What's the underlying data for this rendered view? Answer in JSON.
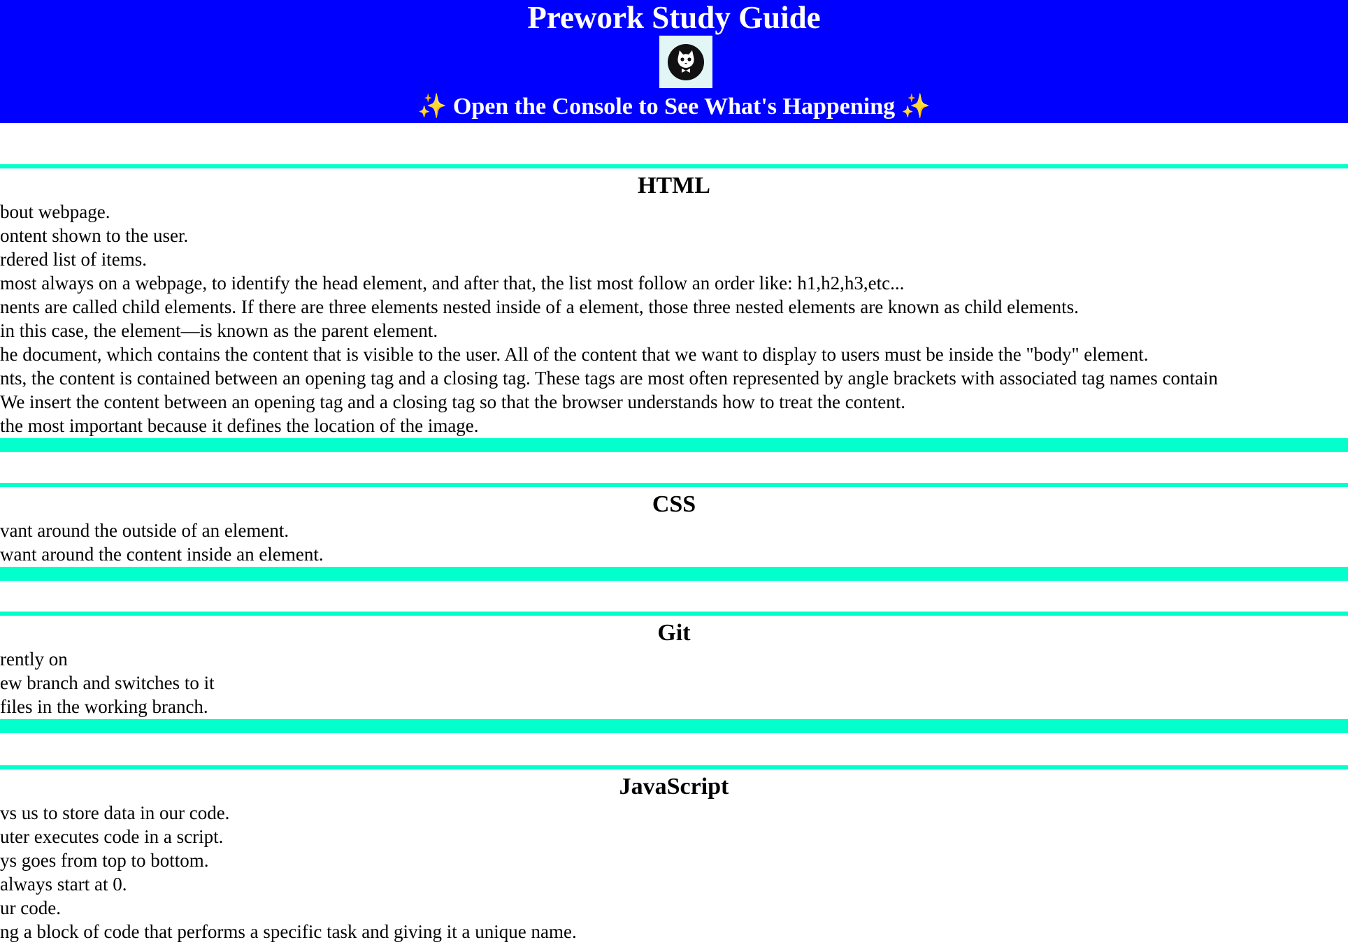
{
  "header": {
    "title": "Prework Study Guide",
    "subtitle_sparkle_left": "✨",
    "subtitle": "Open the Console to See What's Happening",
    "subtitle_sparkle_right": "✨"
  },
  "sections": {
    "html": {
      "heading": "HTML",
      "items": [
        "bout webpage.",
        "ontent shown to the user.",
        "rdered list of items.",
        "most always on a webpage, to identify the head element, and after that, the list most follow an order like: h1,h2,h3,etc...",
        "nents are called child elements. If there are three elements nested inside of a element, those three nested elements are known as child elements.",
        "in this case, the element—is known as the parent element.",
        "he document, which contains the content that is visible to the user. All of the content that we want to display to users must be inside the \"body\" element.",
        "nts, the content is contained between an opening tag and a closing tag. These tags are most often represented by angle brackets with associated tag names contain",
        "We insert the content between an opening tag and a closing tag so that the browser understands how to treat the content.",
        " the most important because it defines the location of the image."
      ]
    },
    "css": {
      "heading": "CSS",
      "items": [
        "vant around the outside of an element.",
        " want around the content inside an element."
      ]
    },
    "git": {
      "heading": "Git",
      "items": [
        "rently on",
        "ew branch and switches to it",
        " files in the working branch."
      ]
    },
    "javascript": {
      "heading": "JavaScript",
      "items": [
        "vs us to store data in our code.",
        "uter executes code in a script.",
        "ys goes from top to bottom.",
        "always start at 0.",
        "ur code.",
        "ng a block of code that performs a specific task and giving it a unique name."
      ]
    }
  },
  "colors": {
    "header_background": "#0000ff",
    "section_border": "#03ffcc",
    "logo_background": "#e3f6f6"
  },
  "icons": {
    "logo": "cat-face-logo-icon"
  }
}
